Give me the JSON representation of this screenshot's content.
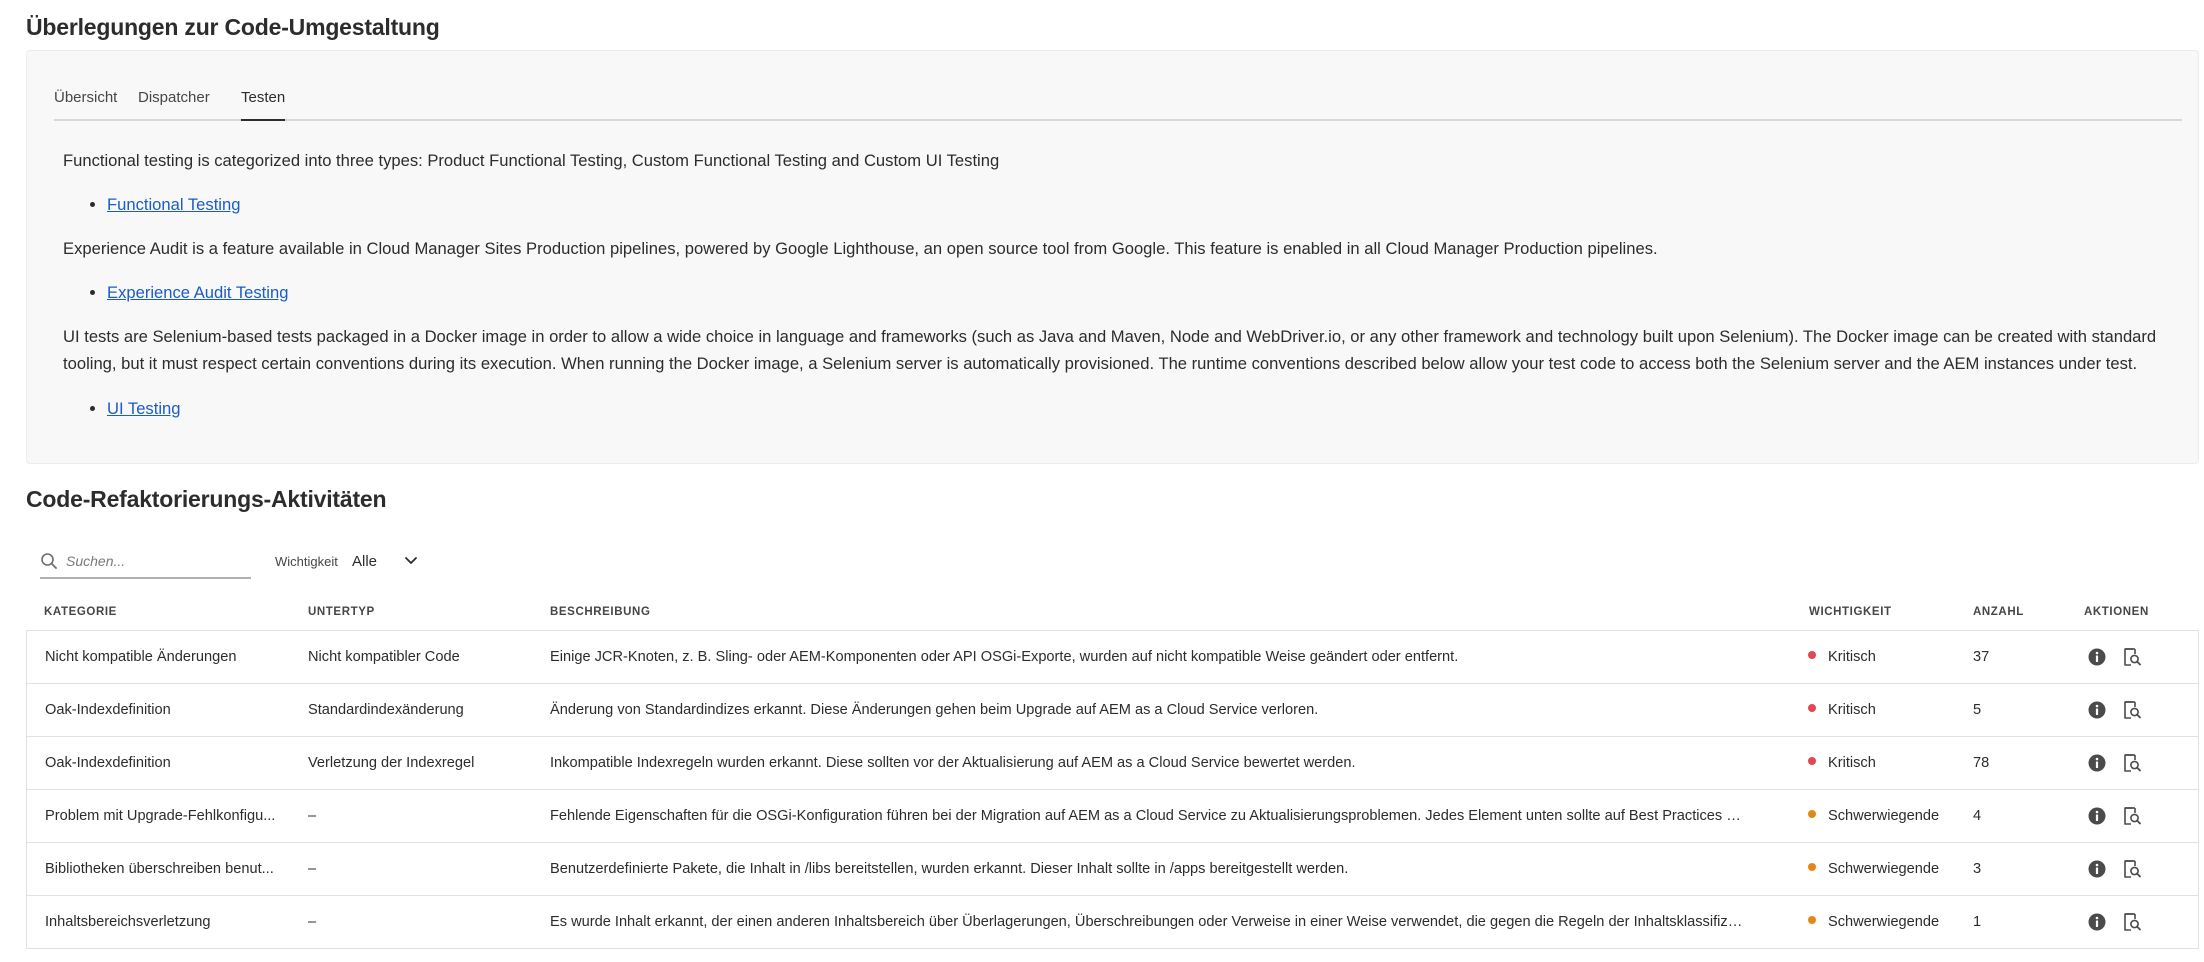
{
  "section1": {
    "title": "Überlegungen zur Code-Umgestaltung",
    "tabs": [
      {
        "label": "Übersicht",
        "selected": false
      },
      {
        "label": "Dispatcher",
        "selected": false
      },
      {
        "label": "Testen",
        "selected": true
      }
    ],
    "content": {
      "p1": "Functional testing is categorized into three types: Product Functional Testing, Custom Functional Testing and Custom UI Testing",
      "link1": "Functional Testing",
      "p2": "Experience Audit is a feature available in Cloud Manager Sites Production pipelines, powered by Google Lighthouse, an open source tool from Google. This feature is enabled in all Cloud Manager Production pipelines.",
      "link2": "Experience Audit Testing",
      "p3": "UI tests are Selenium-based tests packaged in a Docker image in order to allow a wide choice in language and frameworks (such as Java and Maven, Node and WebDriver.io, or any other framework and technology built upon Selenium). The Docker image can be created with standard tooling, but it must respect certain conventions during its execution. When running the Docker image, a Selenium server is automatically provisioned. The runtime conventions described below allow your test code to access both the Selenium server and the AEM instances under test.",
      "link3": "UI Testing"
    }
  },
  "section2": {
    "title": "Code-Refaktorierungs-Aktivitäten",
    "search": {
      "placeholder": "Suchen...",
      "value": ""
    },
    "filter": {
      "label": "Wichtigkeit",
      "value": "Alle"
    },
    "columns": {
      "kategorie": "KATEGORIE",
      "untertyp": "UNTERTYP",
      "beschreibung": "BESCHREIBUNG",
      "wichtigkeit": "WICHTIGKEIT",
      "anzahl": "ANZAHL",
      "aktionen": "AKTIONEN"
    },
    "rows": [
      {
        "kategorie": "Nicht kompatible Änderungen",
        "untertyp": "Nicht kompatibler Code",
        "beschreibung": "Einige JCR-Knoten, z. B. Sling- oder AEM-Komponenten oder API OSGi-Exporte, wurden auf nicht kompatible Weise geändert oder entfernt.",
        "wichtigkeit": "Kritisch",
        "anzahl": "37"
      },
      {
        "kategorie": "Oak-Indexdefinition",
        "untertyp": "Standardindexänderung",
        "beschreibung": "Änderung von Standardindizes erkannt. Diese Änderungen gehen beim Upgrade auf AEM as a Cloud Service verloren.",
        "wichtigkeit": "Kritisch",
        "anzahl": "5"
      },
      {
        "kategorie": "Oak-Indexdefinition",
        "untertyp": "Verletzung der Indexregel",
        "beschreibung": "Inkompatible Indexregeln wurden erkannt. Diese sollten vor der Aktualisierung auf AEM as a Cloud Service bewertet werden.",
        "wichtigkeit": "Kritisch",
        "anzahl": "78"
      },
      {
        "kategorie": "Problem mit Upgrade-Fehlkonfigu...",
        "untertyp": "–",
        "beschreibung": "Fehlende Eigenschaften für die OSGi-Konfiguration führen bei der Migration auf AEM as a Cloud Service zu Aktualisierungsproblemen. Jedes Element unten sollte auf Best Practices hin b...",
        "wichtigkeit": "Schwerwiegende",
        "anzahl": "4"
      },
      {
        "kategorie": "Bibliotheken überschreiben benut...",
        "untertyp": "–",
        "beschreibung": "Benutzerdefinierte Pakete, die Inhalt in /libs bereitstellen, wurden erkannt. Dieser Inhalt sollte in /apps bereitgestellt werden.",
        "wichtigkeit": "Schwerwiegende",
        "anzahl": "3"
      },
      {
        "kategorie": "Inhaltsbereichsverletzung",
        "untertyp": "–",
        "beschreibung": "Es wurde Inhalt erkannt, der einen anderen Inhaltsbereich über Überlagerungen, Überschreibungen oder Verweise in einer Weise verwendet, die gegen die Regeln der Inhaltsklassifizieru...",
        "wichtigkeit": "Schwerwiegende",
        "anzahl": "1"
      }
    ],
    "severity_colors": {
      "Kritisch": "#e34850",
      "Schwerwiegende": "#e68619"
    }
  }
}
